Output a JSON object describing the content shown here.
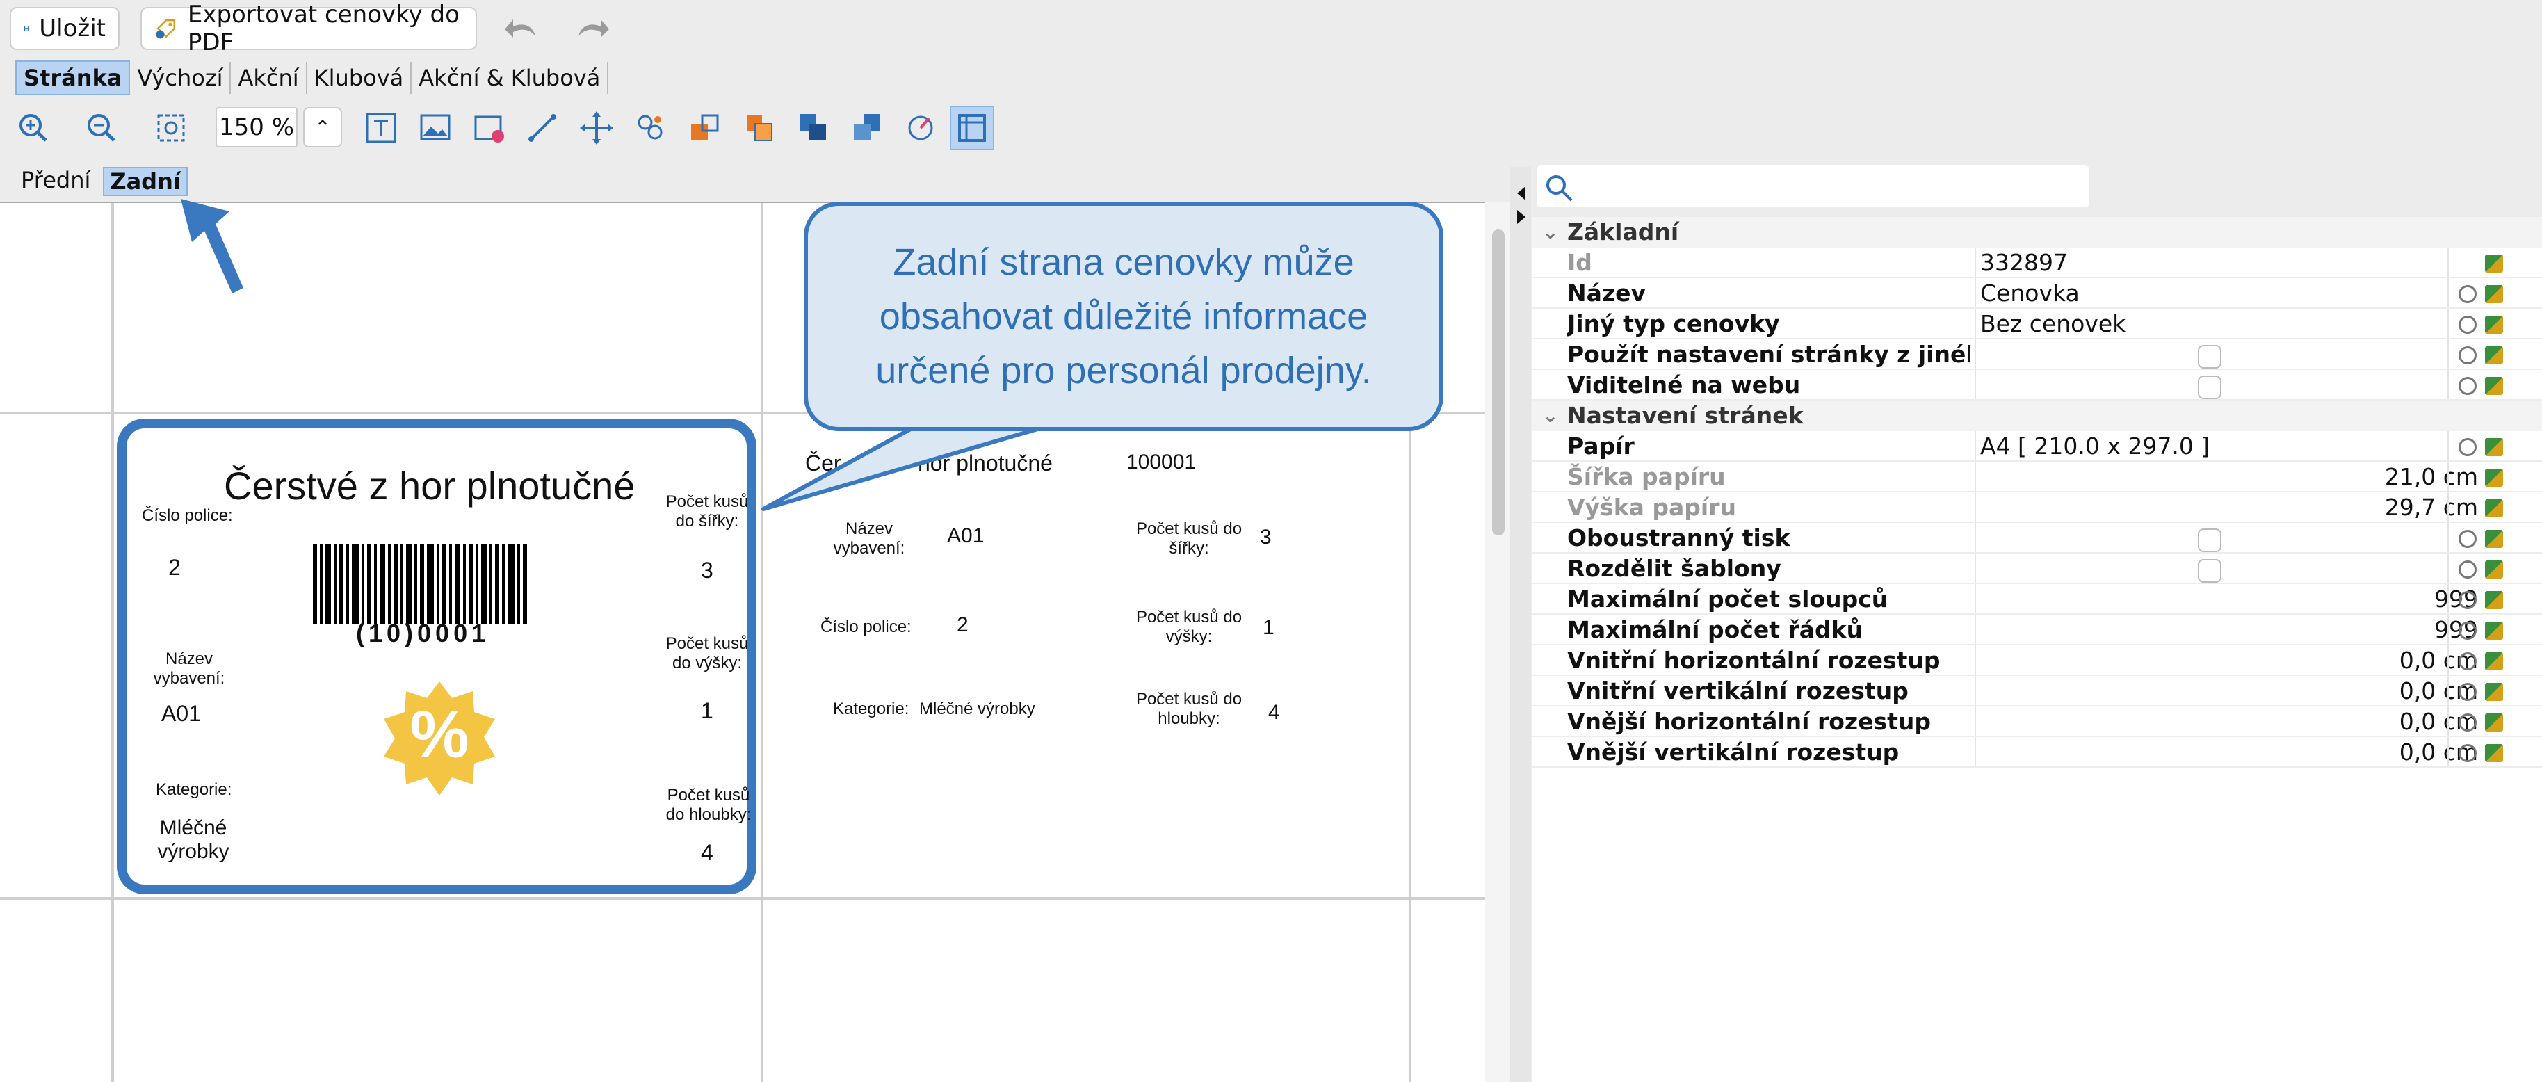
{
  "toolbar": {
    "save_label": "Uložit",
    "export_label": "Exportovat cenovky do PDF"
  },
  "tabs": [
    "Stránka",
    "Výchozí",
    "Akční",
    "Klubová",
    "Akční & Klubová"
  ],
  "zoom": "150 %",
  "side_tabs": [
    "Přední",
    "Zadní"
  ],
  "label_left": {
    "title": "Čerstvé z hor plnotučné",
    "shelf_label": "Číslo police:",
    "shelf_value": "2",
    "width_label": "Počet kusů do šířky:",
    "width_value": "3",
    "barcode_text": "(10)0001",
    "height_label": "Počet kusů do výšky:",
    "height_value": "1",
    "equip_label": "Název vybavení:",
    "equip_value": "A01",
    "category_label": "Kategorie:",
    "category_value": "Mléčné výrobky",
    "depth_label": "Počet kusů do hloubky:",
    "depth_value": "4",
    "badge": "%"
  },
  "label_right": {
    "title_fragment": "Čer",
    "title_rest": "hor plnotučné",
    "code": "100001",
    "equip_label": "Název vybavení:",
    "equip_value": "A01",
    "width_label": "Počet kusů do šířky:",
    "width_value": "3",
    "shelf_label": "Číslo police:",
    "shelf_value": "2",
    "height_label": "Počet kusů do výšky:",
    "height_value": "1",
    "category_label": "Kategorie:",
    "category_value": "Mléčné výrobky",
    "depth_label": "Počet kusů do hloubky:",
    "depth_value": "4"
  },
  "callout": "Zadní strana cenovky může obsahovat důležité informace určené pro personál prodejny.",
  "properties": {
    "sections": [
      "Základní",
      "Nastavení stránek"
    ],
    "rows": [
      {
        "name": "Id",
        "value": "332897"
      },
      {
        "name": "Název",
        "value": "Cenovka"
      },
      {
        "name": "Jiný typ cenovky",
        "value": "Bez cenovek"
      },
      {
        "name": "Použít nastavení stránky z jiného..."
      },
      {
        "name": "Viditelné na webu"
      },
      {
        "name": "Papír",
        "value": "A4 [ 210.0 x 297.0 ]"
      },
      {
        "name": "Šířka papíru",
        "value": "21,0 cm"
      },
      {
        "name": "Výška papíru",
        "value": "29,7 cm"
      },
      {
        "name": "Oboustranný tisk"
      },
      {
        "name": "Rozdělit šablony"
      },
      {
        "name": "Maximální počet sloupců",
        "value": "999"
      },
      {
        "name": "Maximální počet řádků",
        "value": "999"
      },
      {
        "name": "Vnitřní horizontální rozestup",
        "value": "0,0 cm"
      },
      {
        "name": "Vnitřní vertikální rozestup",
        "value": "0,0 cm"
      },
      {
        "name": "Vnější horizontální rozestup",
        "value": "0,0 cm"
      },
      {
        "name": "Vnější vertikální rozestup",
        "value": "0,0 cm"
      }
    ]
  },
  "colors": {
    "accent": "#3a78c0",
    "tab_selected": "#b9d4f2",
    "callout_bg": "#dbe8f4",
    "badge": "#f4c542"
  }
}
